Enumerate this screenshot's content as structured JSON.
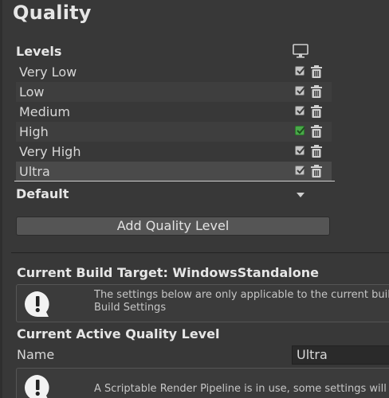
{
  "header": {
    "title": "Quality"
  },
  "levels": {
    "title": "Levels",
    "items": [
      {
        "label": "Very Low",
        "checked": true,
        "highlight": false
      },
      {
        "label": "Low",
        "checked": true,
        "highlight": false
      },
      {
        "label": "Medium",
        "checked": true,
        "highlight": false
      },
      {
        "label": "High",
        "checked": true,
        "highlight": true
      },
      {
        "label": "Very High",
        "checked": true,
        "highlight": false
      },
      {
        "label": "Ultra",
        "checked": true,
        "highlight": false
      }
    ],
    "platform_icon": "monitor-icon",
    "delete_icon": "trash-icon"
  },
  "default": {
    "label": "Default",
    "icon": "dropdown-arrow-icon"
  },
  "add_button": {
    "label": "Add Quality Level"
  },
  "build_target": {
    "title": "Current Build Target: WindowsStandalone",
    "help_line1": "The settings below are only applicable to the current buil",
    "help_line2": "Build Settings"
  },
  "active_level": {
    "title": "Current Active Quality Level",
    "name_label": "Name",
    "name_value": "Ultra",
    "help_line1": "A Scriptable Render Pipeline is in use, some settings will"
  },
  "colors": {
    "background": "#383838",
    "highlight_check": "#4aa84a"
  }
}
